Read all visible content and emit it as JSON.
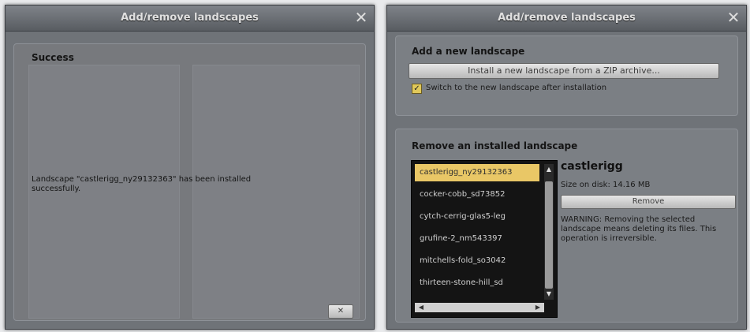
{
  "left_dialog": {
    "title": "Add/remove landscapes",
    "close_glyph": "✕",
    "heading": "Success",
    "message": "Landscape \"castlerigg_ny29132363\" has been installed successfully.",
    "ok_button_label": "✕"
  },
  "right_dialog": {
    "title": "Add/remove landscapes",
    "close_glyph": "✕",
    "add_heading": "Add a new landscape",
    "install_button_label": "Install a new landscape from a ZIP archive...",
    "switch_checkbox_label": "Switch to the new landscape after installation",
    "switch_checked": true,
    "remove_heading": "Remove an installed landscape",
    "landscapes": [
      "castlerigg_ny29132363",
      "cocker-cobb_sd73852",
      "cytch-cerrig-glas5-leg",
      "grufine-2_nm543397",
      "mitchells-fold_so3042",
      "thirteen-stone-hill_sd"
    ],
    "selected_index": 0,
    "selected_name": "castlerigg",
    "size_on_disk": "Size on disk: 14.16 MB",
    "remove_button_label": "Remove",
    "warning": "WARNING: Removing the selected landscape means deleting its files. This operation is irreversible."
  },
  "icons": {
    "close": "close-icon",
    "checkbox": "check-icon",
    "scroll_up": "chevron-up-icon",
    "scroll_down": "chevron-down-icon",
    "scroll_left": "chevron-left-icon",
    "scroll_right": "chevron-right-icon"
  },
  "colors": {
    "dialog_bg": "#6f7378",
    "selection": "#e9c766",
    "list_bg": "#141414"
  }
}
